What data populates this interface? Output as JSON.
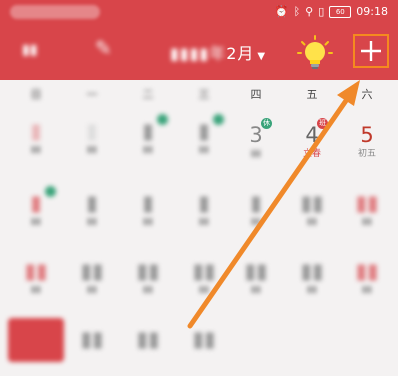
{
  "status": {
    "time": "09:18",
    "battery": "60"
  },
  "header": {
    "month": "2月"
  },
  "weekdays": [
    "日",
    "一",
    "二",
    "三",
    "四",
    "五",
    "六"
  ],
  "days": {
    "d3": {
      "num": "3",
      "badge": "休"
    },
    "d4": {
      "num": "4",
      "sub": "立春",
      "badge": "班"
    },
    "d5": {
      "num": "5",
      "sub": "初五"
    }
  },
  "colors": {
    "header": "#d8454a",
    "highlight": "#f58a1f",
    "rest_badge": "#3aa37a",
    "work_badge": "#d8454a"
  }
}
